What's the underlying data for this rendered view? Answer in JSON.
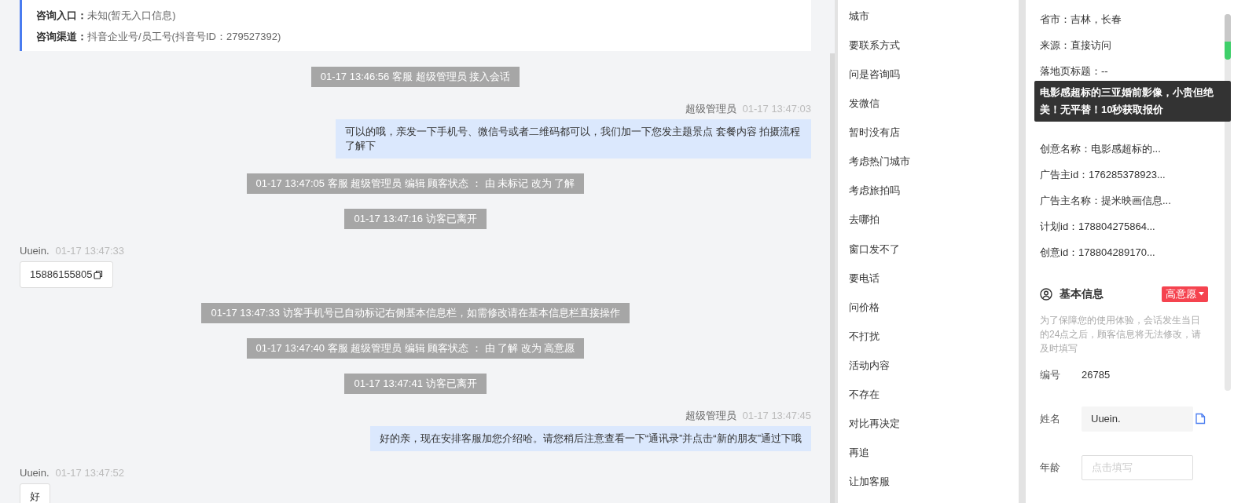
{
  "consult_info": [
    {
      "label": "咨询入口：",
      "value": "未知(暂无入口信息)"
    },
    {
      "label": "咨询渠道：",
      "value": "抖音企业号/员工号(抖音号ID：279527392)"
    }
  ],
  "messages": [
    {
      "kind": "system",
      "text": "01-17 13:46:56 客服 超级管理员 接入会话"
    },
    {
      "kind": "agent",
      "sender": "超级管理员",
      "time": "01-17 13:47:03",
      "text": "可以的哦，亲发一下手机号、微信号或者二维码都可以，我们加一下您发主题景点 套餐内容 拍摄流程了解下"
    },
    {
      "kind": "system",
      "text": "01-17 13:47:05 客服 超级管理员 编辑 顾客状态 ： 由 未标记 改为 了解"
    },
    {
      "kind": "system",
      "text": "01-17 13:47:16 访客已离开"
    },
    {
      "kind": "visitor",
      "sender": "Uuein.",
      "time": "01-17 13:47:33",
      "text": "15886155805",
      "copy_button": true
    },
    {
      "kind": "system",
      "text": "01-17 13:47:33 访客手机号已自动标记右侧基本信息栏，如需修改请在基本信息栏直接操作"
    },
    {
      "kind": "system",
      "text": "01-17 13:47:40 客服 超级管理员 编辑 顾客状态 ： 由 了解 改为 高意愿"
    },
    {
      "kind": "system",
      "text": "01-17 13:47:41 访客已离开"
    },
    {
      "kind": "agent",
      "sender": "超级管理员",
      "time": "01-17 13:47:45",
      "text": "好的亲，现在安排客服加您介绍哈。请您稍后注意查看一下“通讯录”并点击“新的朋友”通过下哦"
    },
    {
      "kind": "visitor",
      "sender": "Uuein.",
      "time": "01-17 13:47:52",
      "text": "好",
      "copy_button": false
    }
  ],
  "quick_replies": [
    "城市",
    "要联系方式",
    "问是咨询吗",
    "发微信",
    "暂时没有店",
    "考虑热门城市",
    "考虑旅拍吗",
    "去哪拍",
    "窗口发不了",
    "要电话",
    "问价格",
    "不打扰",
    "活动内容",
    "不存在",
    "对比再决定",
    "再追",
    "让加客服"
  ],
  "lead_info": {
    "rows_before": [
      "省市：吉林，长春",
      "来源：直接访问",
      "落地页标题：--"
    ],
    "tooltip": "电影感超标的三亚婚前影像，小贵但绝美！无平替！10秒获取报价",
    "rows_after": [
      "创意名称：电影感超标的...",
      "广告主id：176285378923...",
      "广告主名称：提米映画信息...",
      "计划id：178804275864...",
      "创意id：178804289170..."
    ]
  },
  "basic_info": {
    "title": "基本信息",
    "intent": {
      "label": "高意愿",
      "color": "#f5434f"
    },
    "notice": "为了保障您的使用体验，会话发生当日的24点之后，顾客信息将无法修改，请及时填写",
    "fields": [
      {
        "kind": "text",
        "label": "编号",
        "value": "26785"
      },
      {
        "kind": "filled",
        "label": "姓名",
        "value": "Uuein."
      },
      {
        "kind": "input",
        "label": "年龄",
        "placeholder": "点击填写"
      }
    ]
  }
}
